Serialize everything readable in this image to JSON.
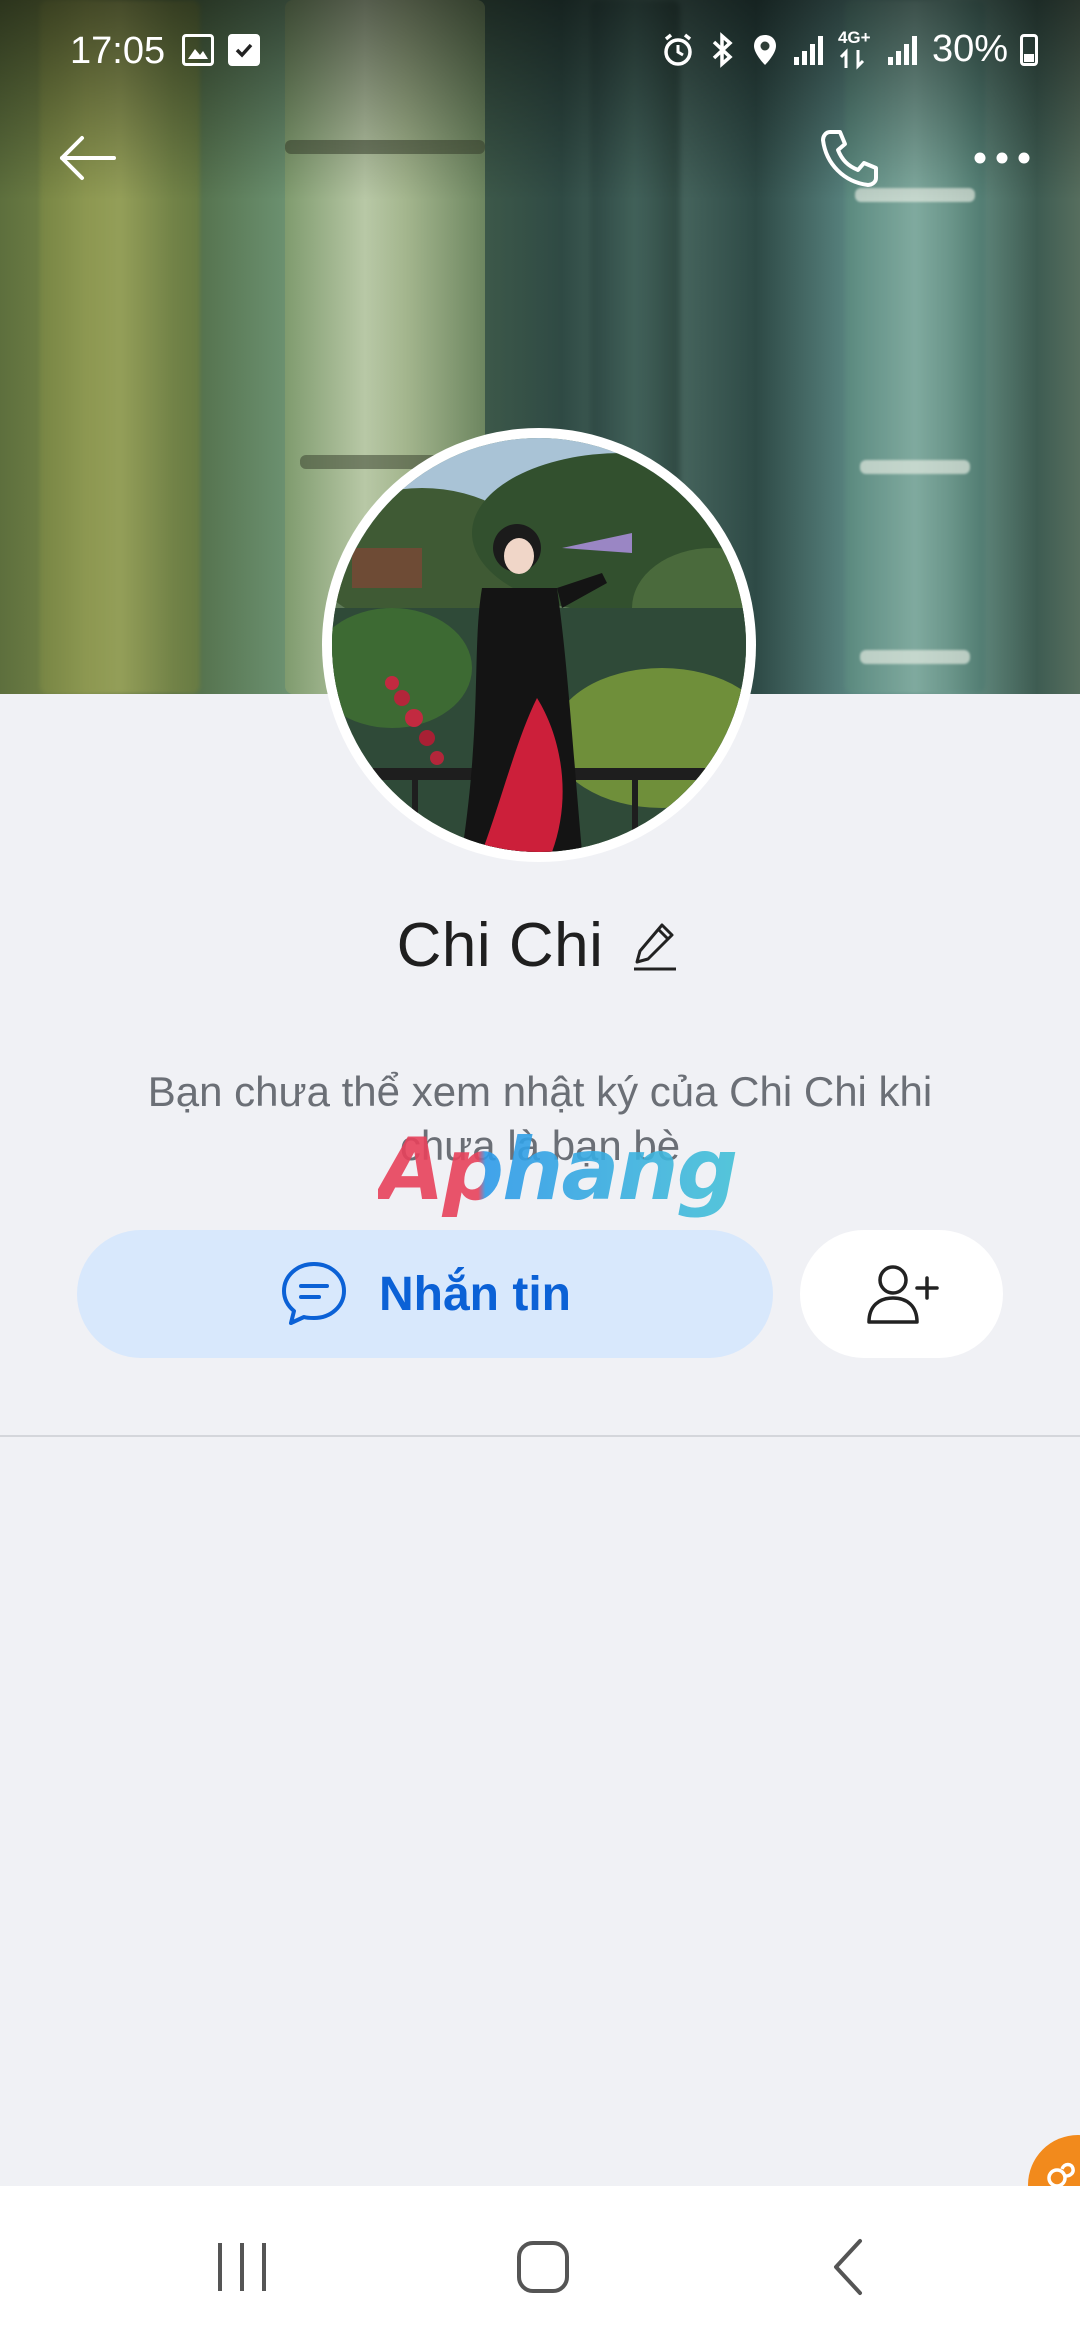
{
  "status_bar": {
    "time": "17:05",
    "battery_text": "30%",
    "icons": [
      "gallery-icon",
      "checkbox-icon",
      "alarm-icon",
      "bluetooth-icon",
      "location-icon",
      "signal-icon",
      "4g-lte-icon",
      "signal-icon",
      "battery-icon"
    ],
    "network_label": "4G+"
  },
  "header": {
    "back_icon": "arrow-left-icon",
    "call_icon": "phone-icon",
    "more_icon": "more-horizontal-icon"
  },
  "profile": {
    "name": "Chi Chi",
    "edit_icon": "pencil-icon",
    "notice": "Bạn chưa thể xem nhật ký của Chi Chi khi chưa là bạn bè"
  },
  "watermark": {
    "text": "Aphang"
  },
  "actions": {
    "message_label": "Nhắn tin",
    "message_icon": "chat-bubble-icon",
    "add_friend_icon": "user-plus-icon"
  },
  "colors": {
    "accent": "#0b61d6",
    "message_button_bg": "#d8e8fc",
    "page_bg": "#f0f1f5",
    "floating_chip": "#f28a1c"
  },
  "nav_bar": {
    "recent_icon": "recent-apps-icon",
    "home_icon": "home-icon",
    "back_icon": "back-chevron-icon"
  }
}
